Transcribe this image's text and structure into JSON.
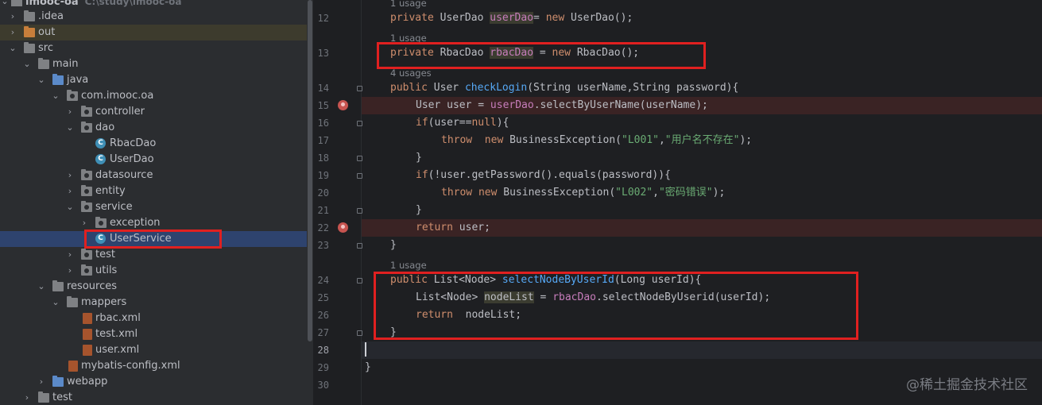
{
  "project_tree": {
    "root": {
      "name": "imooc-oa",
      "path": "C:\\study\\imooc-oa"
    },
    "items": [
      {
        "label": ".idea"
      },
      {
        "label": "out"
      },
      {
        "label": "src"
      },
      {
        "label": "main"
      },
      {
        "label": "java"
      },
      {
        "label": "com.imooc.oa"
      },
      {
        "label": "controller"
      },
      {
        "label": "dao"
      },
      {
        "label": "RbacDao"
      },
      {
        "label": "UserDao"
      },
      {
        "label": "datasource"
      },
      {
        "label": "entity"
      },
      {
        "label": "service"
      },
      {
        "label": "exception"
      },
      {
        "label": "UserService"
      },
      {
        "label": "test"
      },
      {
        "label": "utils"
      },
      {
        "label": "resources"
      },
      {
        "label": "mappers"
      },
      {
        "label": "rbac.xml"
      },
      {
        "label": "test.xml"
      },
      {
        "label": "user.xml"
      },
      {
        "label": "mybatis-config.xml"
      },
      {
        "label": "webapp"
      },
      {
        "label": "test"
      }
    ]
  },
  "editor": {
    "hints": {
      "h11": "1 usage",
      "h12": "1 usage",
      "h13": "4 usages",
      "h23": "1 usage"
    },
    "line_numbers": [
      "12",
      "13",
      "14",
      "15",
      "16",
      "17",
      "18",
      "19",
      "20",
      "21",
      "22",
      "23",
      "24",
      "25",
      "26",
      "27",
      "28",
      "29",
      "30"
    ],
    "code": {
      "l12": {
        "a": "private ",
        "b": "UserDao ",
        "c": "userDao",
        "d": "= ",
        "e": "new ",
        "f": "UserDao();"
      },
      "l13": {
        "a": "private ",
        "b": "RbacDao ",
        "c": "rbacDao",
        "d": " = ",
        "e": "new ",
        "f": "RbacDao();"
      },
      "l14": {
        "a": "public ",
        "b": "User ",
        "c": "checkLogin",
        "d": "(String userName,String password){"
      },
      "l15": {
        "a": "User user = ",
        "b": "userDao",
        "c": ".selectByUserName(userName);"
      },
      "l16": {
        "a": "if",
        "b": "(user==",
        "c": "null",
        "d": "){"
      },
      "l17": {
        "a": "throw  ",
        "b": "new ",
        "c": "BusinessException(",
        "d": "\"L001\"",
        "e": ",",
        "f": "\"用户名不存在\"",
        "g": ");"
      },
      "l18": {
        "a": "}"
      },
      "l19": {
        "a": "if",
        "b": "(!user.getPassword().equals(password)){"
      },
      "l20": {
        "a": "throw ",
        "b": "new ",
        "c": "BusinessException(",
        "d": "\"L002\"",
        "e": ",",
        "f": "\"密码错误\"",
        "g": ");"
      },
      "l21": {
        "a": "}"
      },
      "l22": {
        "a": "return ",
        "b": "user;"
      },
      "l23": {
        "a": "}"
      },
      "l24": {
        "a": "public ",
        "b": "List<Node> ",
        "c": "selectNodeByUserId",
        "d": "(Long userId){"
      },
      "l25": {
        "a": "List<Node> ",
        "b": "nodeList",
        "c": " = ",
        "d": "rbacDao",
        "e": ".selectNodeByUserid(userId);"
      },
      "l26": {
        "a": "return  ",
        "b": "nodeList;"
      },
      "l27": {
        "a": "}"
      },
      "l29": {
        "a": "}"
      }
    }
  },
  "watermark": "@稀土掘金技术社区",
  "colors": {
    "keyword": "#cf8e6d",
    "method": "#56a8f5",
    "field": "#c77dbb",
    "string": "#6aab73",
    "annotation_box": "#e02020"
  },
  "icons": {
    "folder": "folder-icon",
    "class": "java-class-icon",
    "xml": "xml-file-icon",
    "breakpoint": "breakpoint-icon"
  }
}
